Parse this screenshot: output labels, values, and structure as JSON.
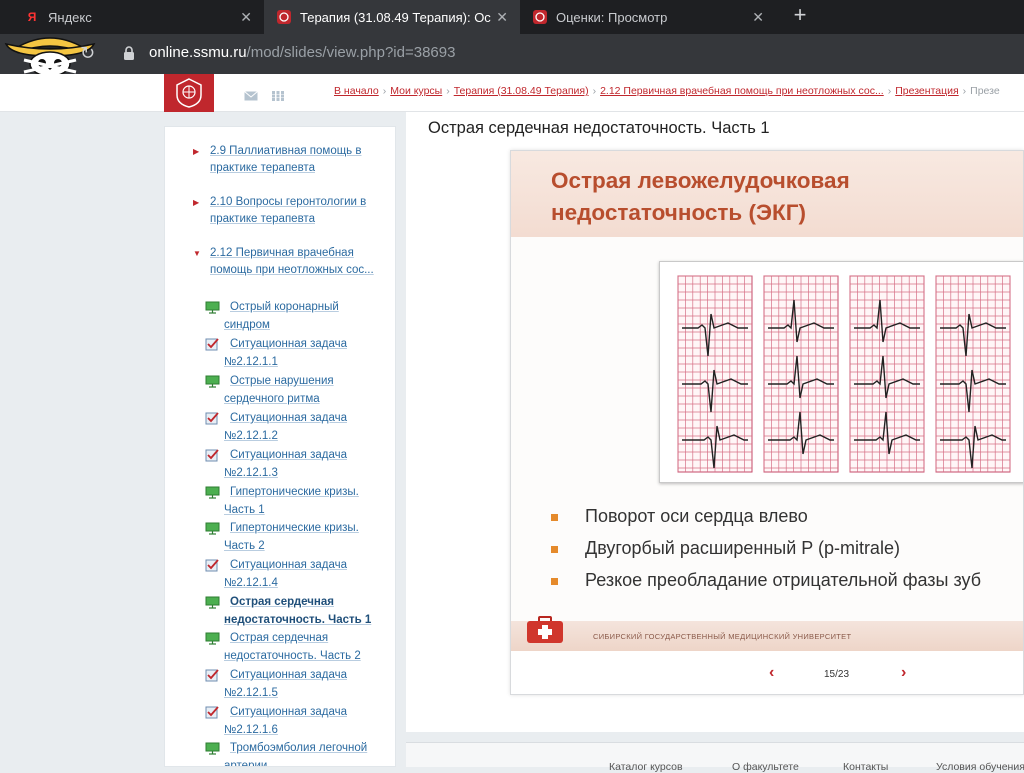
{
  "browser": {
    "tabs": [
      {
        "title": "Яндекс",
        "favicon": "yandex-icon",
        "active": false
      },
      {
        "title": "Терапия (31.08.49 Терапия): Ос",
        "favicon": "university-crest-icon",
        "active": true
      },
      {
        "title": "Оценки: Просмотр",
        "favicon": "university-crest-icon",
        "active": false
      }
    ],
    "url_host": "online.ssmu.ru",
    "url_path": "/mod/slides/view.php?id=38693"
  },
  "breadcrumbs": [
    "В начало",
    "Мои курсы",
    "Терапия (31.08.49 Терапия)",
    "2.12 Первичная врачебная помощь при неотложных сос...",
    "Презентация",
    "Презе"
  ],
  "sidebar": {
    "sections": [
      {
        "label": "2.9 Паллиативная помощь в практике терапевта",
        "expanded": false
      },
      {
        "label": "2.10 Вопросы геронтологии в практике терапевта",
        "expanded": false
      },
      {
        "label": "2.12 Первичная врачебная помощь при неотложных сос...",
        "expanded": true
      }
    ],
    "activities": [
      {
        "label": "Острый коронарный синдром",
        "type": "slides"
      },
      {
        "label": "Ситуационная задача №2.12.1.1",
        "type": "quiz"
      },
      {
        "label": "Острые нарушения сердечного ритма",
        "type": "slides"
      },
      {
        "label": "Ситуационная задача №2.12.1.2",
        "type": "quiz"
      },
      {
        "label": "Ситуационная задача №2.12.1.3",
        "type": "quiz"
      },
      {
        "label": "Гипертонические кризы. Часть 1",
        "type": "slides"
      },
      {
        "label": "Гипертонические кризы. Часть 2",
        "type": "slides"
      },
      {
        "label": "Ситуационная задача №2.12.1.4",
        "type": "quiz"
      },
      {
        "label": "Острая сердечная недостаточность. Часть 1",
        "type": "slides",
        "current": true
      },
      {
        "label": "Острая сердечная недостаточность. Часть 2",
        "type": "slides"
      },
      {
        "label": "Ситуационная задача №2.12.1.5",
        "type": "quiz"
      },
      {
        "label": "Ситуационная задача №2.12.1.6",
        "type": "quiz"
      },
      {
        "label": "Тромбоэмболия легочной артерии",
        "type": "slides"
      }
    ]
  },
  "main": {
    "title": "Острая сердечная недостаточность. Часть 1",
    "slide": {
      "title": "Острая левожелудочковая недостаточность (ЭКГ)",
      "bullets": [
        "Поворот оси сердца влево",
        "Двугорбый расширенный P (p-mitrale)",
        "Резкое преобладание отрицательной фазы зуб"
      ],
      "footer_org": "СИБИРСКИЙ ГОСУДАРСТВЕННЫЙ МЕДИЦИНСКИЙ УНИВЕРСИТЕТ"
    },
    "pager": {
      "current": 15,
      "total": 23,
      "label": "15/23"
    }
  },
  "footer": [
    "Каталог курсов",
    "О факультете",
    "Контакты",
    "Условия обучения"
  ],
  "colors": {
    "accent": "#c0272d",
    "link": "#2b6aa0",
    "slide_title": "#b84e2e",
    "bullet": "#e58a2b"
  }
}
